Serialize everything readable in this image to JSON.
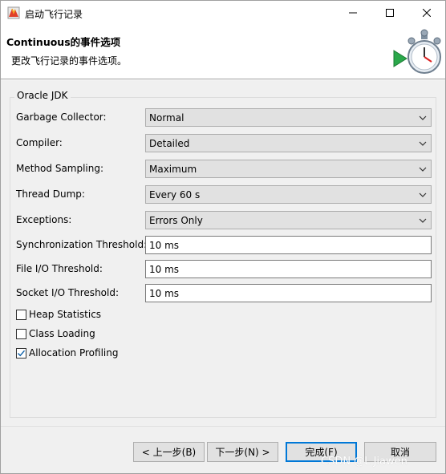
{
  "window": {
    "title": "启动飞行记录"
  },
  "header": {
    "title": "Continuous的事件选项",
    "subtitle": "更改飞行记录的事件选项。"
  },
  "group": {
    "label": "Oracle JDK"
  },
  "fields": {
    "garbage_collector": {
      "label": "Garbage Collector:",
      "value": "Normal"
    },
    "compiler": {
      "label": "Compiler:",
      "value": "Detailed"
    },
    "method_sampling": {
      "label": "Method Sampling:",
      "value": "Maximum"
    },
    "thread_dump": {
      "label": "Thread Dump:",
      "value": "Every 60 s"
    },
    "exceptions": {
      "label": "Exceptions:",
      "value": "Errors Only"
    },
    "sync_threshold": {
      "label": "Synchronization Threshold:",
      "value": "10 ms"
    },
    "file_io_threshold": {
      "label": "File I/O Threshold:",
      "value": "10 ms"
    },
    "socket_io_threshold": {
      "label": "Socket I/O Threshold:",
      "value": "10 ms"
    }
  },
  "checkboxes": {
    "heap_statistics": {
      "label": "Heap Statistics",
      "checked": false
    },
    "class_loading": {
      "label": "Class Loading",
      "checked": false
    },
    "allocation_profiling": {
      "label": "Allocation Profiling",
      "checked": true
    }
  },
  "buttons": {
    "back": "< 上一步(B)",
    "next": "下一步(N) >",
    "finish": "完成(F)",
    "cancel": "取消"
  },
  "watermark": "CSDN @L Jiawen",
  "colors": {
    "accent": "#0078d7",
    "panel_bg": "#f0f0f0",
    "combo_bg": "#e1e1e1"
  }
}
